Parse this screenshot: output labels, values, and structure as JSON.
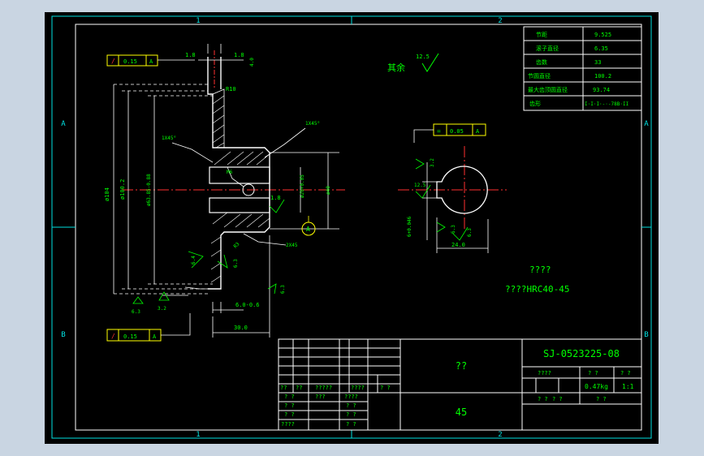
{
  "grid": {
    "col1": "1",
    "col2": "2",
    "rowA": "A",
    "rowB": "B"
  },
  "params": [
    {
      "label": "节距",
      "value": "9.525"
    },
    {
      "label": "滚子直径",
      "value": "6.35"
    },
    {
      "label": "齿数",
      "value": "33"
    },
    {
      "label": "节圆直径",
      "value": "100.2"
    },
    {
      "label": "最大齿顶圆直径",
      "value": "93.74"
    },
    {
      "label": "齿形",
      "value": "I·I·I·-·-78B·II"
    }
  ],
  "roughness_rest": {
    "label": "其余",
    "value": "12.5"
  },
  "tol_frames": [
    {
      "symbol": "/",
      "value": "0.15",
      "datum": "A"
    },
    {
      "symbol": "/",
      "value": "0.15",
      "datum": "A"
    },
    {
      "symbol": "=",
      "value": "0.05",
      "datum": "A"
    }
  ],
  "dims": {
    "top_1": "1.8",
    "top_2": "1.8",
    "top_3": "4.0",
    "dia_104": "ø104",
    "dia_100": "ø100.2",
    "dia_hub": "ø63.85-0.88",
    "chamfer_1": "1X45°",
    "chamfer_2": "1X45°",
    "chamfer_3": "2X45",
    "r10": "R10",
    "bore": "ø20+0.05",
    "outer_40": "ø40",
    "rough_18": "1.8",
    "rough_64": "6.4",
    "rough_63a": "6.3",
    "rough_63b": "6.3",
    "rough_32": "3.2",
    "rough_63c": "6.3",
    "hole": "M6",
    "len_6": "6.0-0.6",
    "len_30": "30.0",
    "datum_label": "A",
    "key_rough_32": "3.2",
    "key_rough_63a": "6.3",
    "key_rough_63b": "6.3",
    "key_rough_125": "12.5",
    "key_6": "6+0.046",
    "key_24": "24.0",
    "r3": "R3"
  },
  "notes": {
    "line1": "????",
    "line2": "????HRC40-45"
  },
  "title_block": {
    "drawing_no": "SJ-0523225-08",
    "name": "??",
    "material": "45",
    "weight_label": "????",
    "weight": "0.47kg",
    "scale": "1:1",
    "hdr_a": "? ?",
    "hdr_b": "? ?",
    "sheet_a": "? ?",
    "sheet_b": "? ?",
    "sheet_c": "? ?",
    "rev_row": [
      "??",
      "??",
      "?????",
      "????",
      "? ?"
    ],
    "rows": [
      [
        "? ?",
        "???",
        "????"
      ],
      [
        "? ?",
        "",
        "? ?"
      ],
      [
        "? ?",
        "",
        "? ?"
      ],
      [
        "????",
        "",
        "? ?"
      ]
    ]
  }
}
